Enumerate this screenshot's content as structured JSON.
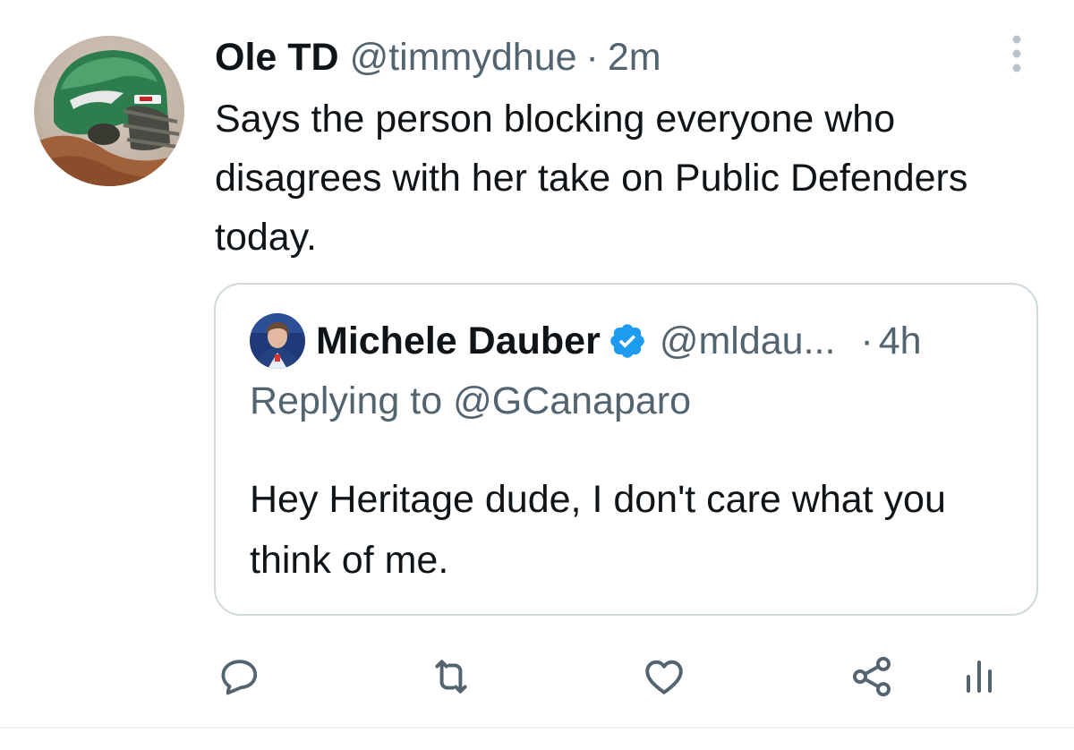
{
  "tweet": {
    "display_name": "Ole TD",
    "handle": "@timmydhue",
    "separator": "·",
    "time": "2m",
    "avatar_icon": "football-helmet-avatar",
    "text": "Says the person blocking everyone who disagrees with her take on Public Defenders today."
  },
  "quote": {
    "display_name": "Michele Dauber",
    "verified": true,
    "verified_color": "#1d9bf0",
    "handle": "@mldau...",
    "separator": "·",
    "time": "4h",
    "replying_to": "Replying to @GCanaparo",
    "text": "Hey Heritage dude, I don't care what you think of me."
  },
  "actions": [
    {
      "icon": "reply-icon"
    },
    {
      "icon": "retweet-icon"
    },
    {
      "icon": "like-icon"
    },
    {
      "icon": "share-icon"
    },
    {
      "icon": "analytics-icon"
    }
  ],
  "colors": {
    "text_primary": "#0f1419",
    "text_secondary": "#536471",
    "border": "#cfd9de",
    "verified": "#1d9bf0"
  }
}
